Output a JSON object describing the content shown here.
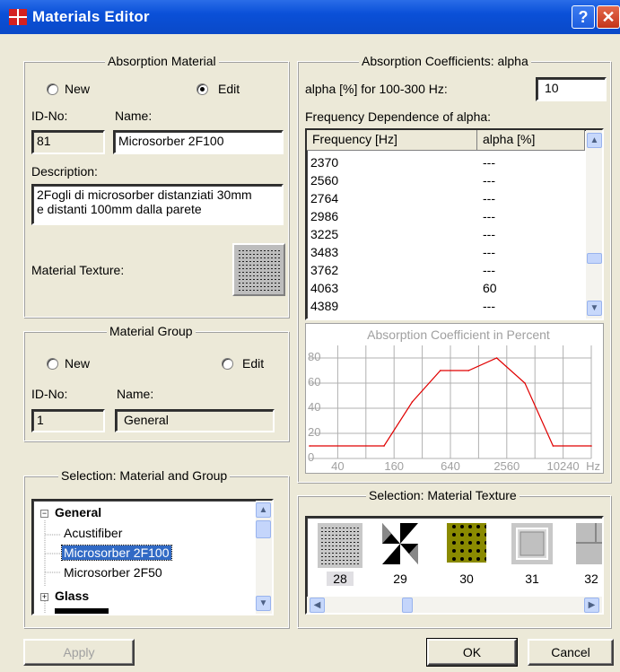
{
  "window": {
    "title": "Materials Editor",
    "help": "?",
    "close": "✕"
  },
  "absorption_material": {
    "legend": "Absorption Material",
    "radio_new": "New",
    "radio_edit": "Edit",
    "selected": "Edit",
    "id_label": "ID-No:",
    "name_label": "Name:",
    "id_value": "81",
    "name_value": "Microsorber 2F100",
    "description_label": "Description:",
    "description_line1": "2Fogli di microsorber distanziati 30mm",
    "description_line2": "e distanti 100mm dalla parete",
    "texture_label": "Material Texture:"
  },
  "material_group": {
    "legend": "Material Group",
    "radio_new": "New",
    "radio_edit": "Edit",
    "id_label": "ID-No:",
    "name_label": "Name:",
    "id_value": "1",
    "name_value": "General"
  },
  "selection_tree": {
    "legend": "Selection: Material and Group",
    "items": [
      {
        "label": "General",
        "level": 0,
        "bold": true,
        "expander": "−"
      },
      {
        "label": "Acustifiber",
        "level": 1
      },
      {
        "label": "Microsorber 2F100",
        "level": 1,
        "selected": true
      },
      {
        "label": "Microsorber 2F50",
        "level": 1
      },
      {
        "label": "Glass",
        "level": 0,
        "bold": true,
        "expander": "+"
      }
    ]
  },
  "absorption_coefficients": {
    "legend": "Absorption Coefficients: alpha",
    "alpha_label": "alpha [%] for 100-300 Hz:",
    "alpha_value": "10",
    "freq_dep_label": "Frequency Dependence of alpha:",
    "col_freq": "Frequency [Hz]",
    "col_alpha": "alpha [%]",
    "rows": [
      {
        "freq": "2370",
        "alpha": "---"
      },
      {
        "freq": "2560",
        "alpha": "---"
      },
      {
        "freq": "2764",
        "alpha": "---"
      },
      {
        "freq": "2986",
        "alpha": "---"
      },
      {
        "freq": "3225",
        "alpha": "---"
      },
      {
        "freq": "3483",
        "alpha": "---"
      },
      {
        "freq": "3762",
        "alpha": "---"
      },
      {
        "freq": "4063",
        "alpha": "60"
      },
      {
        "freq": "4389",
        "alpha": "---"
      }
    ]
  },
  "chart_data": {
    "type": "line",
    "title": "Absorption Coefficient in Percent",
    "xscale": "log",
    "xlim": [
      20,
      20480
    ],
    "ylim": [
      0,
      90
    ],
    "xticks": [
      40,
      160,
      640,
      2560,
      10240
    ],
    "xtick_labels": [
      "40",
      "160",
      "640",
      "2560",
      "10240"
    ],
    "x_unit": "Hz",
    "yticks": [
      0,
      20,
      40,
      60,
      80
    ],
    "ytick_labels": [
      "0",
      "20",
      "40",
      "60",
      "80"
    ],
    "grid": true,
    "series": [
      {
        "color": "#e00000",
        "x": [
          20,
          125,
          250,
          500,
          1000,
          2000,
          4000,
          8000,
          20480
        ],
        "y": [
          10,
          10,
          45,
          70,
          70,
          80,
          60,
          10,
          10
        ]
      }
    ]
  },
  "texture_selection": {
    "legend": "Selection: Material Texture",
    "items": [
      {
        "label": "28",
        "selected": true
      },
      {
        "label": "29"
      },
      {
        "label": "30"
      },
      {
        "label": "31"
      },
      {
        "label": "32"
      }
    ]
  },
  "buttons": {
    "apply": "Apply",
    "ok": "OK",
    "cancel": "Cancel"
  },
  "colors": {
    "titlebar": "#0a50d8",
    "selection": "#316ac5",
    "chart_line": "#e00000"
  }
}
